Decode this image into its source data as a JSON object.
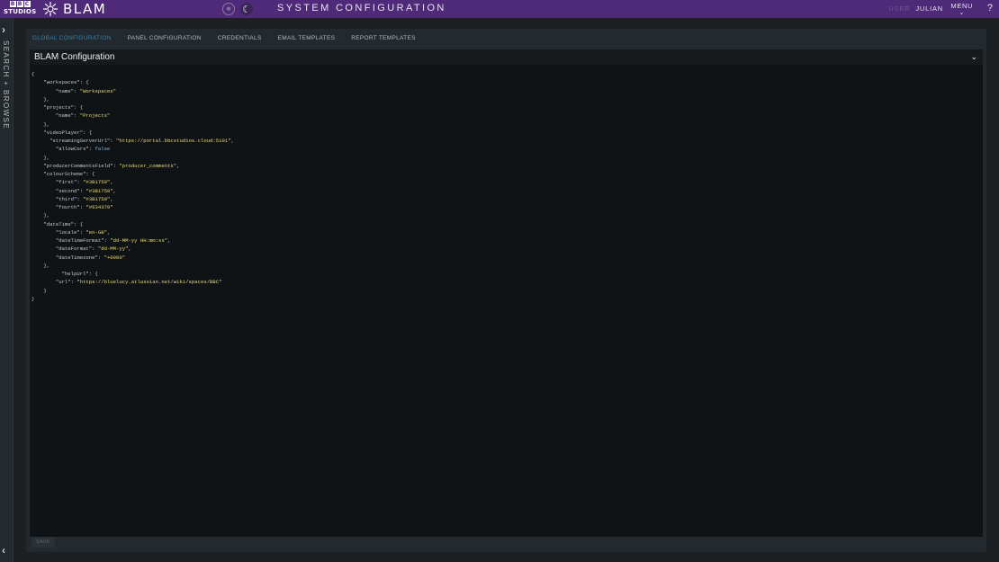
{
  "brand": {
    "bbc_letters": [
      "B",
      "B",
      "C"
    ],
    "studios": "STUDIOS",
    "app_name": "BLAM"
  },
  "header": {
    "title": "SYSTEM CONFIGURATION",
    "user_label": "USER",
    "user_name": "JULIAN",
    "menu_label": "MENU",
    "help_label": "?"
  },
  "left_rail": {
    "label": "SEARCH + BROWSE"
  },
  "tabs": [
    {
      "label": "GLOBAL CONFIGURATION",
      "active": true
    },
    {
      "label": "PANEL CONFIGURATION"
    },
    {
      "label": "CREDENTIALS"
    },
    {
      "label": "EMAIL TEMPLATES"
    },
    {
      "label": "REPORT TEMPLATES"
    }
  ],
  "section": {
    "title": "BLAM Configuration"
  },
  "config_lines": [
    "{",
    "    \"workspaces\": {",
    "        \"name\": \"Workspaces\"",
    "    },",
    "    \"projects\": {",
    "        \"name\": \"Projects\"",
    "    },",
    "    \"videoPlayer\": {",
    "      \"streamingServerUrl\": \"https://portal.bbcstudios.cloud:5101\",",
    "        \"allowCors\": false",
    "    },",
    "    \"producerCommentsField\": \"producer_comments\",",
    "    \"colourScheme\": {",
    "        \"first\": \"#3B1759\",",
    "        \"second\": \"#3B1759\",",
    "        \"third\": \"#3B1759\",",
    "        \"fourth\": \"#634379\"",
    "    },",
    "    \"dateTime\": {",
    "        \"locale\": \"en-GB\",",
    "        \"dateTimeFormat\": \"dd-MM-yy HH:mm:ss\",",
    "        \"dateFormat\": \"dd-MM-yy\",",
    "        \"dateTimezone\": \"+0000\"",
    "    },",
    "          \"helpUrl\": {",
    "        \"url\": \"https://bluelucy.atlassian.net/wiki/spaces/BBC\"",
    "    }",
    "}"
  ],
  "footer": {
    "save_label": "SAVE"
  },
  "colors": {
    "topbar": "#4f2a78",
    "active_tab": "#3b7ea6",
    "string": "#e6db74",
    "boolean": "#7dbde8"
  },
  "icons": [
    "bbc-studios-logo",
    "blam-logo-icon",
    "sun-icon",
    "moon-icon",
    "chevron-right-icon",
    "chevron-left-icon",
    "chevron-down-icon",
    "help-icon"
  ]
}
